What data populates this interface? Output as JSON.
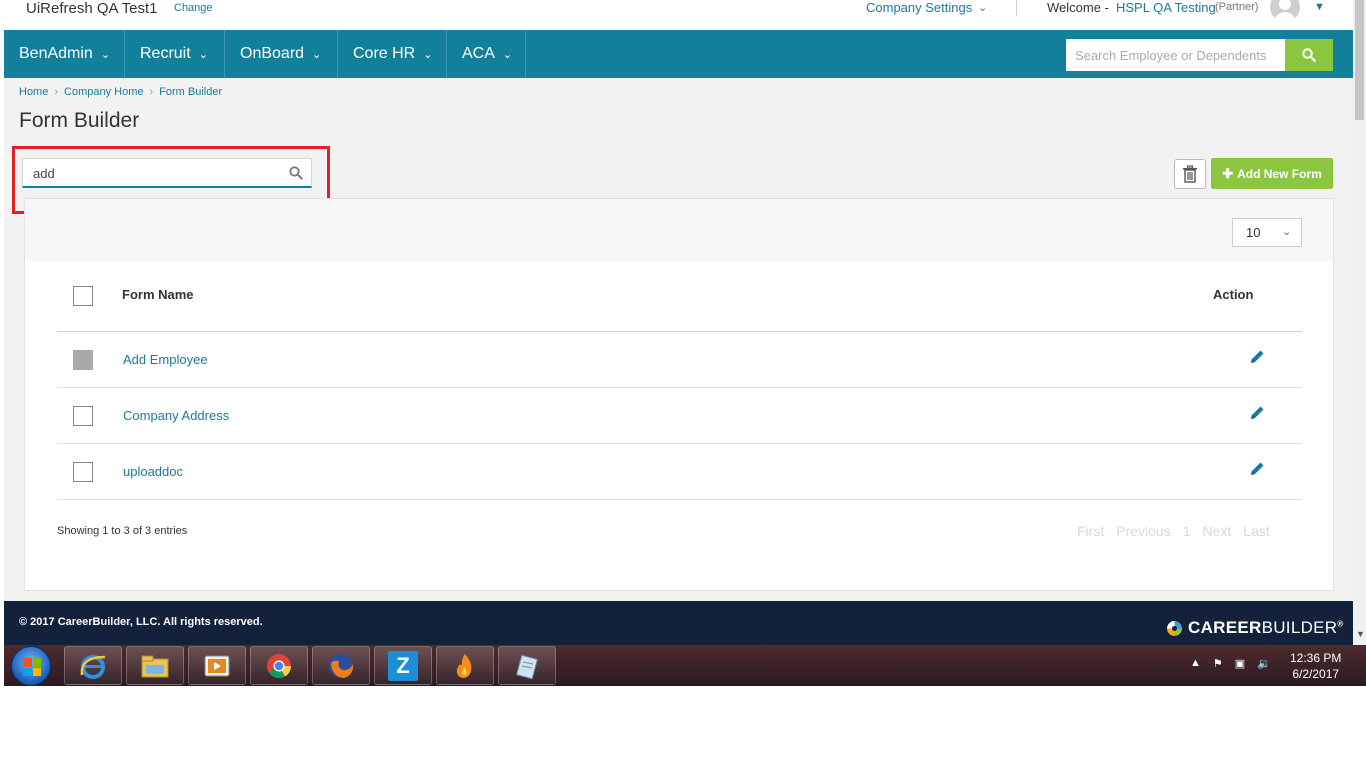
{
  "topbar": {
    "company_name": "UiRefresh QA Test1",
    "change_label": "Change",
    "company_settings": "Company Settings",
    "welcome": "Welcome -",
    "user_name": "HSPL QA Testing",
    "user_role": "(Partner)"
  },
  "nav": {
    "items": [
      {
        "label": "BenAdmin"
      },
      {
        "label": "Recruit"
      },
      {
        "label": "OnBoard"
      },
      {
        "label": "Core HR"
      },
      {
        "label": "ACA"
      }
    ],
    "search_placeholder": "Search Employee or Dependents"
  },
  "breadcrumb": [
    "Home",
    "Company Home",
    "Form Builder"
  ],
  "page_title": "Form Builder",
  "filter": {
    "value": "add"
  },
  "buttons": {
    "add_new_form": "Add New Form"
  },
  "table": {
    "page_size": "10",
    "columns": {
      "name": "Form Name",
      "action": "Action"
    },
    "rows": [
      {
        "name": "Add Employee",
        "checked": true
      },
      {
        "name": "Company Address",
        "checked": false
      },
      {
        "name": "uploaddoc",
        "checked": false
      }
    ],
    "entries_info": "Showing 1 to 3 of 3 entries",
    "pager": {
      "first": "First",
      "previous": "Previous",
      "page": "1",
      "next": "Next",
      "last": "Last"
    }
  },
  "footer": {
    "copyright": "© 2017 CareerBuilder, LLC. All rights reserved.",
    "logo_bold": "CAREER",
    "logo_thin": "BUILDER",
    "logo_mark": "®"
  },
  "taskbar": {
    "time": "12:36 PM",
    "date": "6/2/2017"
  },
  "colors": {
    "primary": "#12809b",
    "accent_green": "#8cc63f",
    "link": "#1a7a9a",
    "footer": "#13223a",
    "highlight": "#e0202a"
  }
}
